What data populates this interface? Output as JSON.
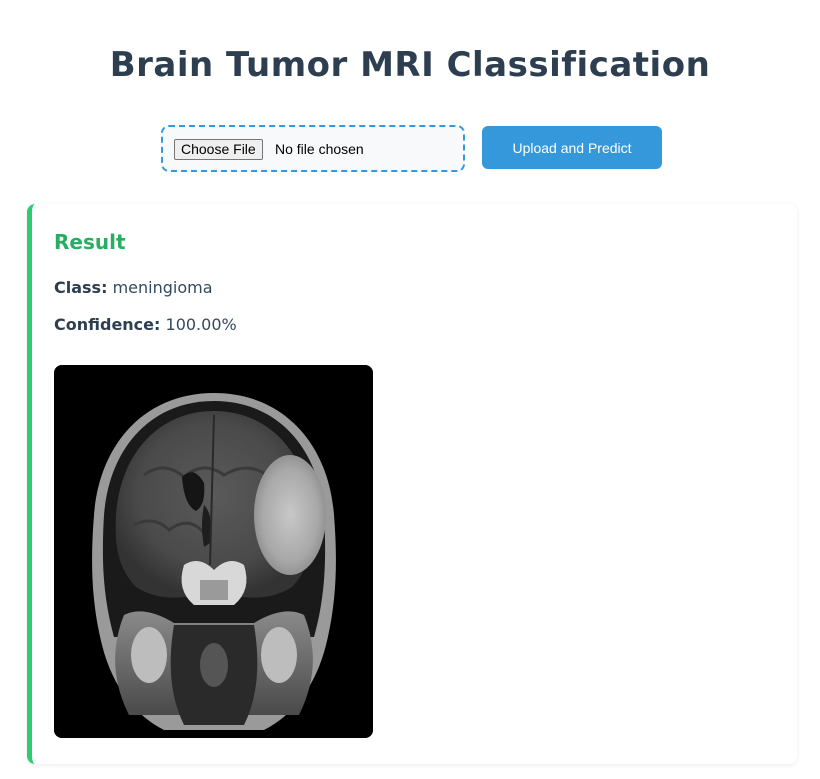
{
  "header": {
    "title": "Brain Tumor MRI Classification"
  },
  "upload": {
    "choose_file_label": "Choose File",
    "file_status": "No file chosen",
    "submit_label": "Upload and Predict",
    "accent_color": "#3498db"
  },
  "result": {
    "heading": "Result",
    "class_label": "Class:",
    "class_value": "meningioma",
    "confidence_label": "Confidence:",
    "confidence_value": "100.00%",
    "accent_color": "#2ecc71"
  }
}
